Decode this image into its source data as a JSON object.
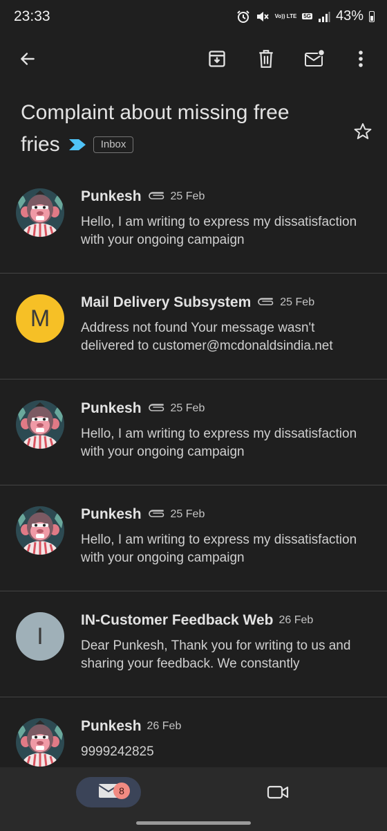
{
  "status_bar": {
    "time": "23:33",
    "network_label": "5G",
    "volte_label": "Vo)) LTE",
    "battery_percent": "43%",
    "icons": [
      "alarm-icon",
      "mute-icon",
      "volte-icon",
      "5g-icon",
      "signal-icon",
      "battery-icon"
    ]
  },
  "toolbar": {
    "icons": [
      "back-arrow-icon",
      "archive-icon",
      "delete-icon",
      "mark-unread-icon",
      "more-vert-icon"
    ]
  },
  "subject": {
    "line1": "Complaint about missing free",
    "line2": "fries",
    "label": "Inbox",
    "importance_color": "#4fc3f7"
  },
  "messages": [
    {
      "sender": "Punkesh",
      "date": "25 Feb",
      "has_attachment": true,
      "snippet": "Hello, I am writing to express my dissatisfaction with your ongoing campaign",
      "avatar": "monkey-avatar"
    },
    {
      "sender": "Mail Delivery Subsystem",
      "date": "25 Feb",
      "has_attachment": true,
      "snippet": "Address not found Your message wasn't delivered to customer@mcdonaldsindia.net",
      "avatar_letter": "M",
      "avatar_color": "#f6c026"
    },
    {
      "sender": "Punkesh",
      "date": "25 Feb",
      "has_attachment": true,
      "snippet": "Hello, I am writing to express my dissatisfaction with your ongoing campaign",
      "avatar": "monkey-avatar"
    },
    {
      "sender": "Punkesh",
      "date": "25 Feb",
      "has_attachment": true,
      "snippet": "Hello, I am writing to express my dissatisfaction with your ongoing campaign",
      "avatar": "monkey-avatar"
    },
    {
      "sender": "IN-Customer Feedback Web",
      "date": "26 Feb",
      "has_attachment": false,
      "snippet": "Dear Punkesh, Thank you for writing to us and sharing your feedback. We constantly",
      "avatar_letter": "I",
      "avatar_color": "#9fb0b8"
    },
    {
      "sender": "Punkesh",
      "date": "26 Feb",
      "has_attachment": false,
      "snippet": "9999242825",
      "avatar": "monkey-avatar"
    }
  ],
  "bottom_nav": {
    "mail_badge": "8",
    "icons": [
      "mail-icon",
      "video-call-icon"
    ]
  }
}
